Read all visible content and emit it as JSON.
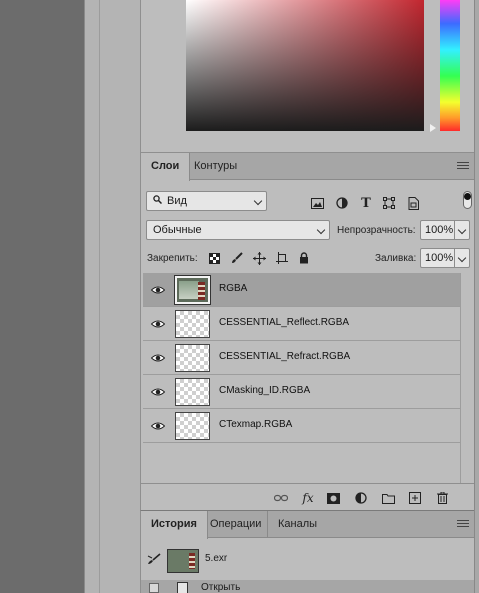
{
  "layers_panel": {
    "tabs": [
      "Слои",
      "Контуры"
    ],
    "filter": {
      "selected": "Вид"
    },
    "blend_mode": "Обычные",
    "opacity": {
      "label": "Непрозрачность:",
      "value": "100%"
    },
    "lock": {
      "label": "Закрепить:"
    },
    "fill": {
      "label": "Заливка:",
      "value": "100%"
    },
    "layers": [
      {
        "name": "RGBA",
        "visible": true,
        "selected": true
      },
      {
        "name": "CESSENTIAL_Reflect.RGBA",
        "visible": true,
        "selected": false
      },
      {
        "name": "CESSENTIAL_Refract.RGBA",
        "visible": true,
        "selected": false
      },
      {
        "name": "CMasking_ID.RGBA",
        "visible": true,
        "selected": false
      },
      {
        "name": "CTexmap.RGBA",
        "visible": true,
        "selected": false
      }
    ]
  },
  "history_panel": {
    "tabs": [
      "История",
      "Операции",
      "Каналы"
    ],
    "snapshot": "5.exr",
    "steps": [
      "Открыть"
    ]
  },
  "colors": {
    "field_base": "#c2262f",
    "panel_bg": "#bdbdbd",
    "workspace": "#6c6c6c"
  }
}
